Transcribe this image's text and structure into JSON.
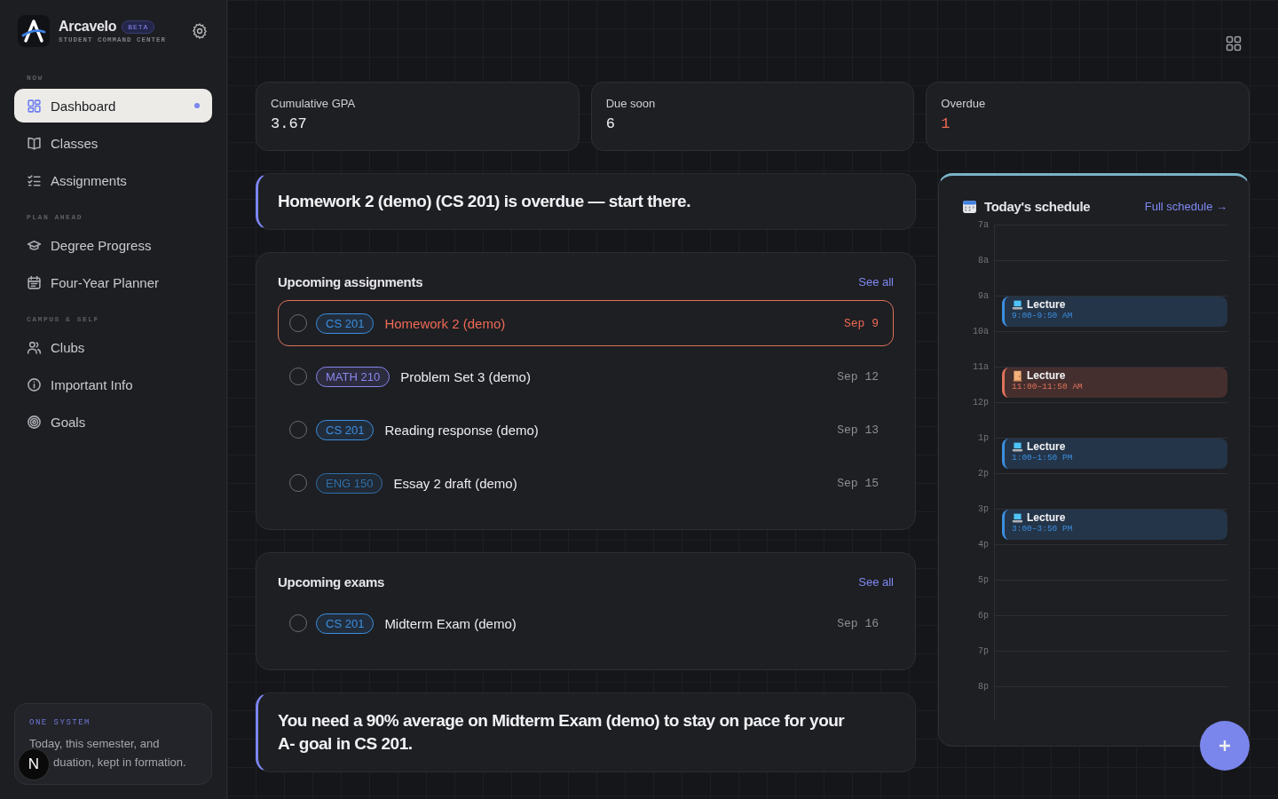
{
  "brand": {
    "name": "Arcavelo",
    "badge": "BETA",
    "tagline": "STUDENT COMMAND CENTER"
  },
  "sidebar": {
    "sections": [
      {
        "heading": "NOW",
        "items": [
          {
            "label": "Dashboard",
            "selected": true
          },
          {
            "label": "Classes",
            "selected": false
          },
          {
            "label": "Assignments",
            "selected": false
          }
        ]
      },
      {
        "heading": "PLAN AHEAD",
        "items": [
          {
            "label": "Degree Progress",
            "selected": false
          },
          {
            "label": "Four-Year Planner",
            "selected": false
          }
        ]
      },
      {
        "heading": "CAMPUS & SELF",
        "items": [
          {
            "label": "Clubs",
            "selected": false
          },
          {
            "label": "Important Info",
            "selected": false
          },
          {
            "label": "Goals",
            "selected": false
          }
        ]
      }
    ],
    "footer": {
      "eyebrow": "ONE SYSTEM",
      "lines": [
        "Today, this semester, and",
        "duation, kept in formation."
      ]
    }
  },
  "stats": [
    {
      "label": "Cumulative GPA",
      "value": "3.67",
      "alert": false
    },
    {
      "label": "Due soon",
      "value": "6",
      "alert": false
    },
    {
      "label": "Overdue",
      "value": "1",
      "alert": true
    }
  ],
  "callouts": [
    {
      "text": "Homework 2 (demo) (CS 201) is overdue — start there."
    },
    {
      "text": "You need a 90% average on Midterm Exam (demo) to stay on pace for your A- goal in CS 201."
    }
  ],
  "assignments": {
    "title": "Upcoming assignments",
    "link": "See all",
    "items": [
      {
        "course": "CS 201",
        "color": "#3b8fe0",
        "title": "Homework 2 (demo)",
        "due": "Sep 9",
        "checked": false,
        "overdue": true
      },
      {
        "course": "MATH 210",
        "color": "#8a86ee",
        "title": "Problem Set 3 (demo)",
        "due": "Sep 12",
        "checked": false,
        "overdue": false
      },
      {
        "course": "CS 201",
        "color": "#3b8fe0",
        "title": "Reading response (demo)",
        "due": "Sep 13",
        "checked": false,
        "overdue": false
      },
      {
        "course": "ENG 150",
        "color": "#2f6fa8",
        "title": "Essay 2 draft (demo)",
        "due": "Sep 15",
        "checked": false,
        "overdue": false
      }
    ]
  },
  "exams": {
    "title": "Upcoming exams",
    "link": "See all",
    "items": [
      {
        "course": "CS 201",
        "color": "#3b8fe0",
        "title": "Midterm Exam (demo)",
        "due": "Sep 16",
        "checked": false,
        "overdue": false
      }
    ]
  },
  "schedule": {
    "title": "Today's schedule",
    "link": "Full schedule →",
    "hours": [
      {
        "label": "7a"
      },
      {
        "label": "8a"
      },
      {
        "label": "9a",
        "events": [
          {
            "title": "Lecture",
            "time": "9:00–9:50 AM",
            "kind": "virtual",
            "color": "#3b8fe0"
          }
        ]
      },
      {
        "label": "10a"
      },
      {
        "label": "11a",
        "events": [
          {
            "title": "Lecture",
            "time": "11:00–11:50 AM",
            "kind": "room",
            "color": "#e0725a"
          }
        ]
      },
      {
        "label": "12p"
      },
      {
        "label": "1p",
        "events": [
          {
            "title": "Lecture",
            "time": "1:00–1:50 PM",
            "kind": "virtual",
            "color": "#3b8fe0"
          }
        ]
      },
      {
        "label": "2p"
      },
      {
        "label": "3p",
        "events": [
          {
            "title": "Lecture",
            "time": "3:00–3:50 PM",
            "kind": "virtual",
            "color": "#3b8fe0"
          }
        ]
      },
      {
        "label": "4p"
      },
      {
        "label": "5p"
      },
      {
        "label": "6p"
      },
      {
        "label": "7p"
      },
      {
        "label": "8p"
      }
    ]
  },
  "dev_badge": {
    "letter": "N"
  }
}
